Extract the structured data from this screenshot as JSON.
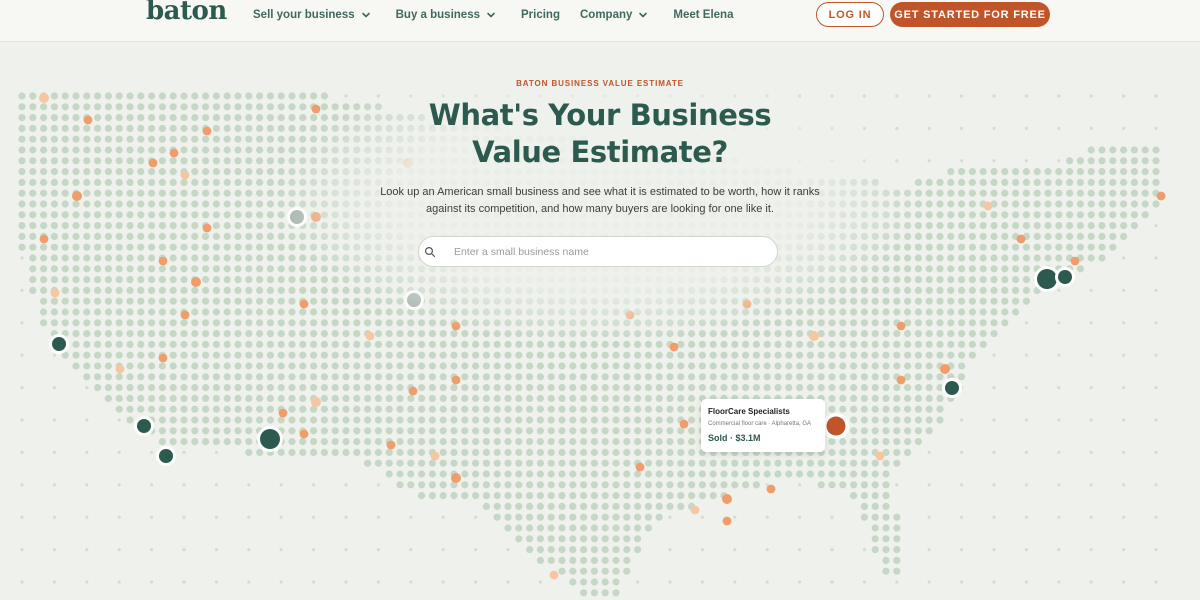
{
  "header": {
    "logo": "baton",
    "nav": [
      {
        "label": "Sell your business",
        "dropdown": true
      },
      {
        "label": "Buy a business",
        "dropdown": true
      },
      {
        "label": "Pricing",
        "dropdown": false
      },
      {
        "label": "Company",
        "dropdown": true
      },
      {
        "label": "Meet Elena",
        "dropdown": false
      }
    ],
    "login_label": "LOG IN",
    "cta_label": "GET STARTED FOR FREE"
  },
  "hero": {
    "eyebrow": "BATON BUSINESS VALUE ESTIMATE",
    "title_line1": "What's Your Business",
    "title_line2": "Value Estimate?",
    "subtitle": "Look up an American small business and see what it is estimated to be worth, how it ranks against its competition, and how many buyers are looking for one like it.",
    "search_placeholder": "Enter a small business name"
  },
  "map_card": {
    "name": "FloorCare Specialists",
    "description": "Commercial floor care · Alpharetta, GA",
    "sold": "Sold · $3.1M"
  },
  "colors": {
    "brand_green": "#2c5a4f",
    "accent_orange": "#c0552a",
    "dot_green": "#c6d7c6",
    "dot_orange": "#ef9d6a",
    "background": "#eff1ec"
  },
  "icons": {
    "nav_dropdown": "chevron-down-icon",
    "search": "search-icon"
  }
}
